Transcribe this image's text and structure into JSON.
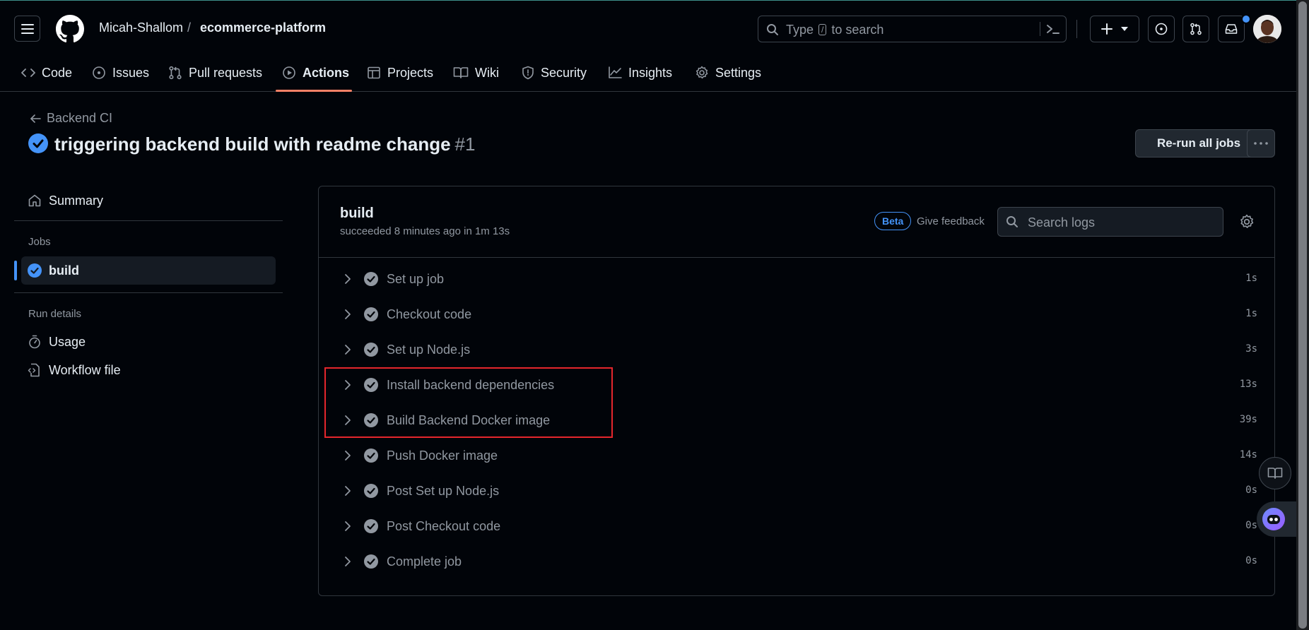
{
  "header": {
    "owner": "Micah-Shallom",
    "separator": "/",
    "repo": "ecommerce-platform",
    "search_before": "Type",
    "search_key": "/",
    "search_after": "to search"
  },
  "nav": {
    "items": [
      {
        "label": "Code",
        "icon": "code-icon"
      },
      {
        "label": "Issues",
        "icon": "issue-opened-icon"
      },
      {
        "label": "Pull requests",
        "icon": "pull-request-icon"
      },
      {
        "label": "Actions",
        "icon": "play-icon",
        "active": true
      },
      {
        "label": "Projects",
        "icon": "table-icon"
      },
      {
        "label": "Wiki",
        "icon": "book-icon"
      },
      {
        "label": "Security",
        "icon": "shield-icon"
      },
      {
        "label": "Insights",
        "icon": "graph-icon"
      },
      {
        "label": "Settings",
        "icon": "gear-icon"
      }
    ]
  },
  "run": {
    "back_label": "Backend CI",
    "title": "triggering backend build with readme change",
    "number": "#1",
    "rerun_label": "Re-run all jobs"
  },
  "sidebar": {
    "summary": "Summary",
    "jobs_heading": "Jobs",
    "job": "build",
    "run_details_heading": "Run details",
    "usage": "Usage",
    "workflow_file": "Workflow file"
  },
  "job": {
    "name": "build",
    "status": "succeeded 8 minutes ago in 1m 13s",
    "beta": "Beta",
    "feedback": "Give feedback",
    "search_placeholder": "Search logs",
    "steps": [
      {
        "label": "Set up job",
        "duration": "1s"
      },
      {
        "label": "Checkout code",
        "duration": "1s"
      },
      {
        "label": "Set up Node.js",
        "duration": "3s"
      },
      {
        "label": "Install backend dependencies",
        "duration": "13s"
      },
      {
        "label": "Build Backend Docker image",
        "duration": "39s"
      },
      {
        "label": "Push Docker image",
        "duration": "14s"
      },
      {
        "label": "Post Set up Node.js",
        "duration": "0s"
      },
      {
        "label": "Post Checkout code",
        "duration": "0s"
      },
      {
        "label": "Complete job",
        "duration": "0s"
      }
    ]
  },
  "colors": {
    "background": "#010409",
    "accent_blue": "#4493f8",
    "active_tab_underline": "#f78166",
    "annotation_red": "#e5262c"
  }
}
